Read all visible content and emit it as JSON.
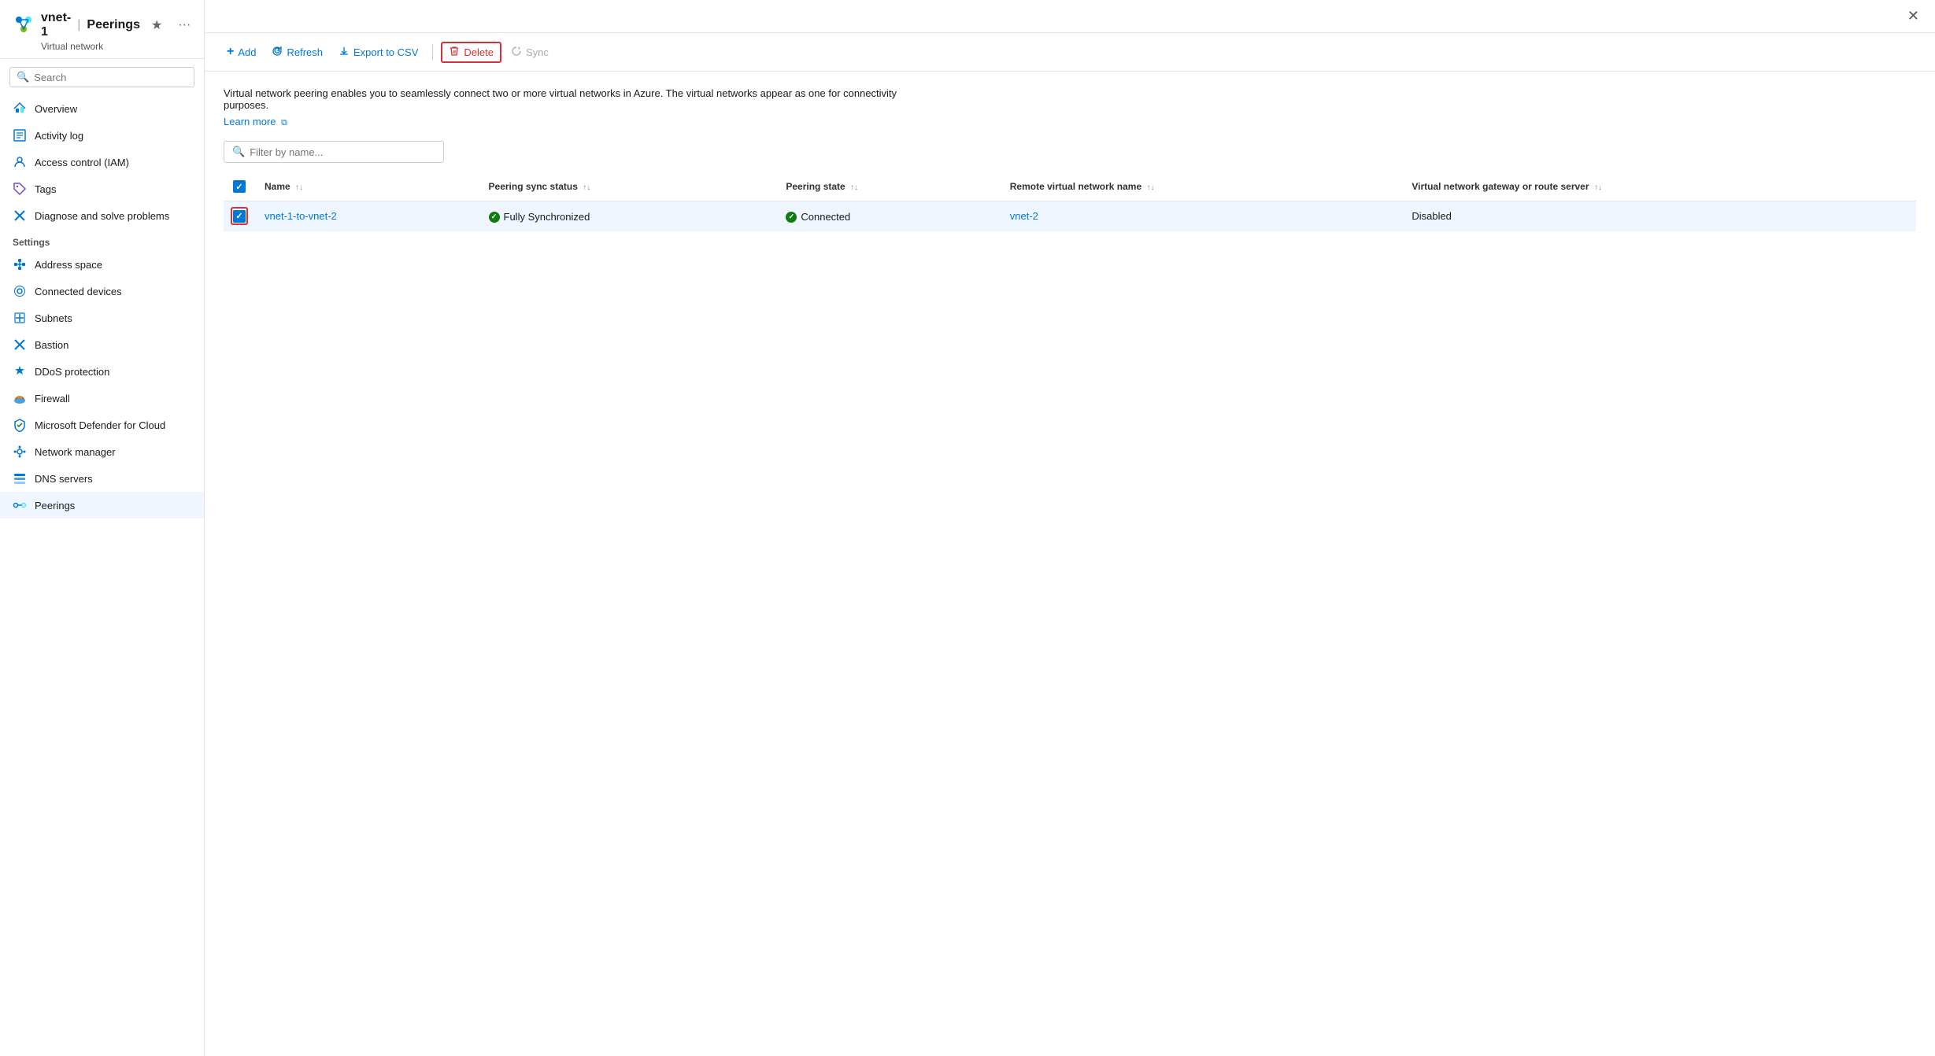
{
  "header": {
    "resource_name": "vnet-1",
    "separator": "|",
    "page_title": "Peerings",
    "subtitle": "Virtual network",
    "star_icon": "★",
    "more_icon": "···",
    "close_icon": "✕"
  },
  "sidebar": {
    "search_placeholder": "Search",
    "collapse_icon": "«",
    "nav_items": [
      {
        "id": "overview",
        "label": "Overview",
        "icon": "<>",
        "icon_type": "overview"
      },
      {
        "id": "activity-log",
        "label": "Activity log",
        "icon": "≡",
        "icon_type": "list"
      },
      {
        "id": "access-control",
        "label": "Access control (IAM)",
        "icon": "👤",
        "icon_type": "person"
      },
      {
        "id": "tags",
        "label": "Tags",
        "icon": "🏷",
        "icon_type": "tag"
      },
      {
        "id": "diagnose",
        "label": "Diagnose and solve problems",
        "icon": "✖",
        "icon_type": "wrench"
      }
    ],
    "settings_label": "Settings",
    "settings_items": [
      {
        "id": "address-space",
        "label": "Address space",
        "icon": "<>",
        "icon_type": "address"
      },
      {
        "id": "connected-devices",
        "label": "Connected devices",
        "icon": "⊙",
        "icon_type": "devices"
      },
      {
        "id": "subnets",
        "label": "Subnets",
        "icon": "<>",
        "icon_type": "subnets"
      },
      {
        "id": "bastion",
        "label": "Bastion",
        "icon": "✖",
        "icon_type": "bastion"
      },
      {
        "id": "ddos-protection",
        "label": "DDoS protection",
        "icon": "🛡",
        "icon_type": "shield"
      },
      {
        "id": "firewall",
        "label": "Firewall",
        "icon": "☁",
        "icon_type": "firewall"
      },
      {
        "id": "defender",
        "label": "Microsoft Defender for Cloud",
        "icon": "🛡",
        "icon_type": "defender"
      },
      {
        "id": "network-manager",
        "label": "Network manager",
        "icon": "⚙",
        "icon_type": "network"
      },
      {
        "id": "dns-servers",
        "label": "DNS servers",
        "icon": "▤",
        "icon_type": "dns"
      },
      {
        "id": "peerings",
        "label": "Peerings",
        "icon": "<>",
        "icon_type": "peerings",
        "active": true
      }
    ]
  },
  "toolbar": {
    "add_label": "Add",
    "add_icon": "+",
    "refresh_label": "Refresh",
    "refresh_icon": "↺",
    "export_label": "Export to CSV",
    "export_icon": "↓",
    "delete_label": "Delete",
    "delete_icon": "🗑",
    "sync_label": "Sync",
    "sync_icon": "↻"
  },
  "content": {
    "description": "Virtual network peering enables you to seamlessly connect two or more virtual networks in Azure. The virtual networks appear as one for connectivity purposes.",
    "learn_more": "Learn more",
    "external_link_icon": "⧉",
    "filter_placeholder": "Filter by name...",
    "table": {
      "columns": [
        {
          "id": "name",
          "label": "Name",
          "sort": true
        },
        {
          "id": "peering-sync-status",
          "label": "Peering sync status",
          "sort": true
        },
        {
          "id": "peering-state",
          "label": "Peering state",
          "sort": true
        },
        {
          "id": "remote-vnet-name",
          "label": "Remote virtual network name",
          "sort": true
        },
        {
          "id": "gateway-or-route-server",
          "label": "Virtual network gateway or route server",
          "sort": true
        }
      ],
      "rows": [
        {
          "id": "row-1",
          "selected": true,
          "name": "vnet-1-to-vnet-2",
          "peering_sync_status": "Fully Synchronized",
          "peering_sync_status_icon": "check",
          "peering_state": "Connected",
          "peering_state_icon": "check",
          "remote_vnet_name": "vnet-2",
          "gateway_or_route_server": "Disabled"
        }
      ]
    }
  }
}
